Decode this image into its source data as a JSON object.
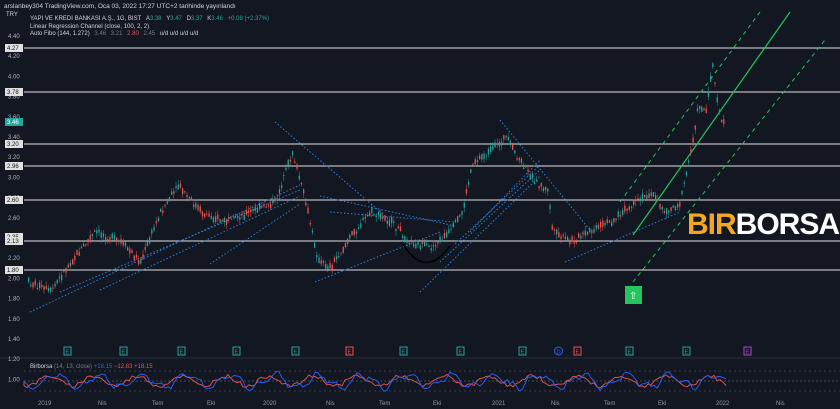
{
  "caption": "arslanbey304 TradingView.com, Oca 03, 2022 17:27 UTC+2 tarihinde yayınlandı",
  "currency": "TRY",
  "legend": {
    "symbol": "YAPI VE KREDI BANKASI A.Ş., 1G, BIST",
    "ohlc": [
      {
        "k": "A",
        "v": "3.38"
      },
      {
        "k": "Y",
        "v": "3.47"
      },
      {
        "k": "D",
        "v": "3.37"
      },
      {
        "k": "K",
        "v": "3.46"
      }
    ],
    "change": "+0.08 (+2.37%)",
    "regression": "Linear Regression Channel (close, 100, 2, 2)",
    "fibo": "Auto Fibo (144, 1.272)",
    "fibo_values": [
      "3.46",
      "3.21",
      "2.80",
      "2.45"
    ],
    "fibo_tail": "u/d  u/d  u/d  u/d"
  },
  "price_axis": {
    "ticks": [
      "4.40",
      "4.20",
      "4.00",
      "3.80",
      "3.60",
      "3.40",
      "3.20",
      "3.00",
      "2.80",
      "2.60",
      "2.40",
      "2.20",
      "2.00",
      "1.80",
      "1.60",
      "1.40",
      "1.20",
      "1.00"
    ],
    "badges": [
      "4.27",
      "3.78",
      "3.46",
      "3.20",
      "2.96",
      "2.60",
      "2.35",
      "2.13",
      "1.80"
    ],
    "current": "3.46",
    "accent": "#26a69a"
  },
  "indicator": {
    "name": "Birborsa",
    "params": "(14, 13, close)",
    "v1": "+18.15",
    "v2": "−12.83",
    "v3": "+18.15",
    "line_colors": [
      "#2962ff",
      "#ef5350"
    ]
  },
  "x_axis": [
    "2019",
    "Nis",
    "Tem",
    "Eki",
    "2020",
    "Nis",
    "Tem",
    "Eki",
    "2021",
    "Nis",
    "Tem",
    "Eki",
    "2022",
    "Nis"
  ],
  "events": {
    "E_green": "E",
    "E_red": "E",
    "D": "D",
    "up_arrow": "⇧",
    "colors": {
      "green": "#26a69a",
      "red": "#ef5350",
      "purple": "#b045d6",
      "blue": "#2962ff"
    }
  },
  "logo": {
    "part1": "BIR",
    "part2": "BORSA"
  }
}
